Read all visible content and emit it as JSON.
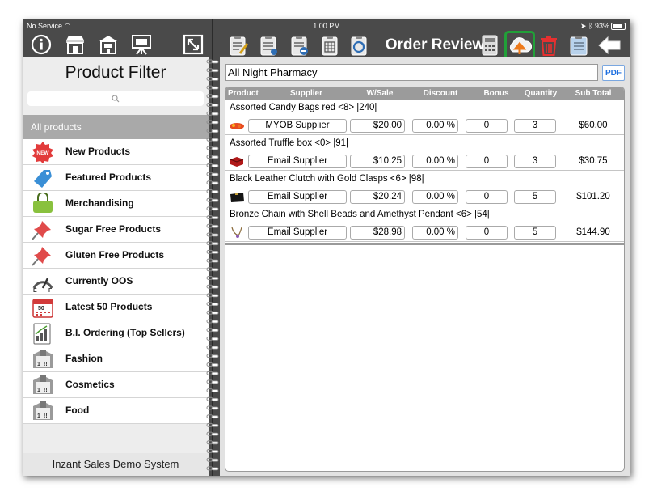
{
  "statusbar": {
    "carrier": "No Service",
    "time": "1:00 PM",
    "battery": "93%"
  },
  "toolbar": {
    "title": "Order Review",
    "left_icons": [
      "info-icon",
      "store-icon",
      "shop-icon",
      "presentation-icon",
      "expand-icon"
    ],
    "right_icons": [
      "clipboard-pen-icon",
      "clipboard-doc-icon",
      "clipboard-minus-icon",
      "clipboard-list-icon",
      "sync-icon"
    ],
    "action_icons": [
      "calculator-icon",
      "cloud-upload-icon",
      "trash-icon",
      "clipboard-icon",
      "back-arrow-icon"
    ],
    "accent": "#21a038"
  },
  "sidebar": {
    "title": "Product Filter",
    "search_placeholder": "",
    "all_products": "All products",
    "items": [
      {
        "label": "New Products",
        "icon": "new-badge-icon"
      },
      {
        "label": "Featured Products",
        "icon": "tag-icon"
      },
      {
        "label": "Merchandising",
        "icon": "bag-icon"
      },
      {
        "label": "Sugar Free Products",
        "icon": "pushpin-icon"
      },
      {
        "label": "Gluten Free Products",
        "icon": "pushpin-icon"
      },
      {
        "label": "Currently OOS",
        "icon": "gauge-icon"
      },
      {
        "label": "Latest 50 Products",
        "icon": "calendar-icon"
      },
      {
        "label": "B.I. Ordering (Top Sellers)",
        "icon": "bar-chart-icon"
      },
      {
        "label": "Fashion",
        "icon": "box-icon"
      },
      {
        "label": "Cosmetics",
        "icon": "box-icon"
      },
      {
        "label": "Food",
        "icon": "box-icon"
      }
    ],
    "footer": "Inzant Sales Demo System"
  },
  "order": {
    "customer": "All Night Pharmacy",
    "pdf_label": "PDF",
    "columns": [
      "Product",
      "Supplier",
      "W/Sale",
      "Discount",
      "Bonus",
      "Quantity",
      "Sub Total"
    ],
    "rows": [
      {
        "name": "Assorted Candy Bags red <8> |240|",
        "supplier": "MYOB Supplier",
        "wsale": "$20.00",
        "discount": "0.00 %",
        "bonus": "0",
        "quantity": "3",
        "subtotal": "$60.00",
        "thumb": "candy-thumb"
      },
      {
        "name": "Assorted Truffle box <0> |91|",
        "supplier": "Email Supplier",
        "wsale": "$10.25",
        "discount": "0.00 %",
        "bonus": "0",
        "quantity": "3",
        "subtotal": "$30.75",
        "thumb": "truffle-thumb"
      },
      {
        "name": "Black Leather Clutch with Gold Clasps <6> |98|",
        "supplier": "Email Supplier",
        "wsale": "$20.24",
        "discount": "0.00 %",
        "bonus": "0",
        "quantity": "5",
        "subtotal": "$101.20",
        "thumb": "clutch-thumb"
      },
      {
        "name": "Bronze Chain with Shell Beads and Amethyst Pendant <6> |54|",
        "supplier": "Email Supplier",
        "wsale": "$28.98",
        "discount": "0.00 %",
        "bonus": "0",
        "quantity": "5",
        "subtotal": "$144.90",
        "thumb": "necklace-thumb"
      }
    ]
  }
}
